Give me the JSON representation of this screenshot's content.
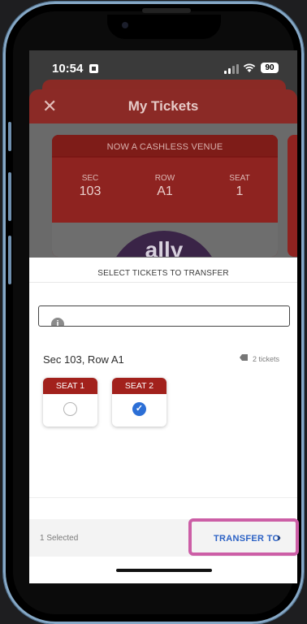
{
  "status_bar": {
    "time": "10:54",
    "battery": "90"
  },
  "header": {
    "title": "My Tickets"
  },
  "ticket": {
    "banner": "NOW A CASHLESS VENUE",
    "sec_label": "SEC",
    "sec_value": "103",
    "row_label": "ROW",
    "row_value": "A1",
    "seat_label": "SEAT",
    "seat_value": "1",
    "logo": "ally"
  },
  "transfer_panel": {
    "title": "SELECT TICKETS TO TRANSFER",
    "section_row": "Sec 103, Row A1",
    "ticket_count": "2 tickets",
    "seats": [
      {
        "label": "SEAT 1",
        "selected": false
      },
      {
        "label": "SEAT 2",
        "selected": true
      }
    ]
  },
  "footer": {
    "selected_text": "1 Selected",
    "transfer_label": "TRANSFER TO",
    "accent": "#2c62c5",
    "highlight_color": "#cc5ea6"
  }
}
